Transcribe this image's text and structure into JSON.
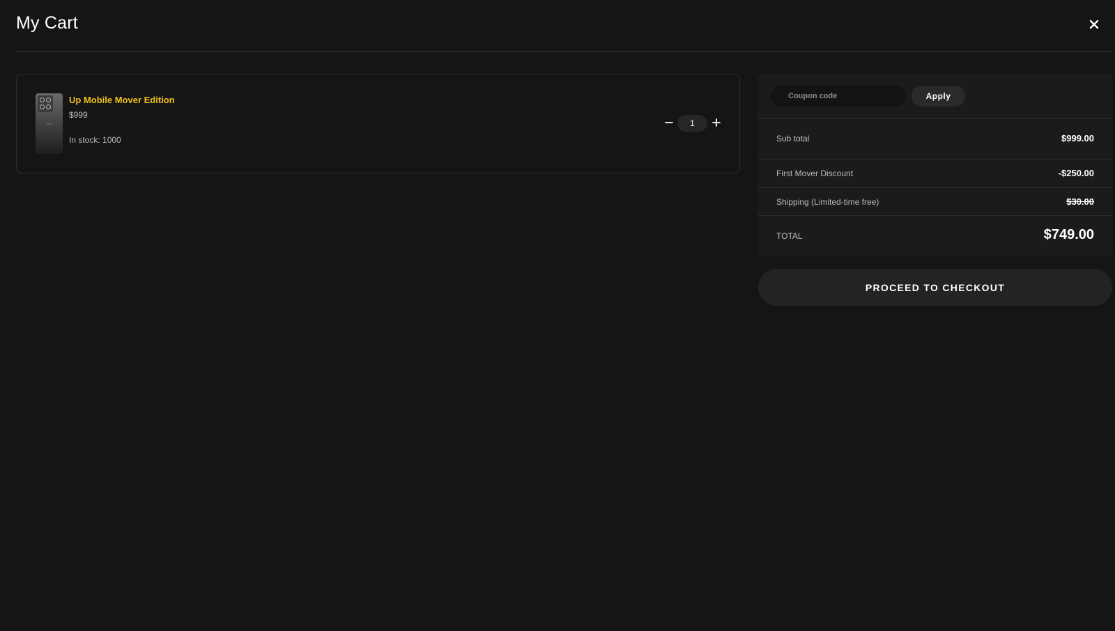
{
  "header": {
    "title": "My Cart",
    "close_icon": "close-icon"
  },
  "cart": {
    "items": [
      {
        "name": "Up Mobile Mover Edition",
        "price": "$999",
        "stock": "In stock: 1000",
        "quantity": "1",
        "image_icon": "phone-product-image"
      }
    ],
    "minus_icon": "minus-icon",
    "plus_icon": "plus-icon"
  },
  "summary": {
    "coupon_placeholder": "Coupon code",
    "apply_label": "Apply",
    "rows": [
      {
        "label": "Sub total",
        "value": "$999.00",
        "strike": false
      },
      {
        "label": "First Mover Discount",
        "value": "-$250.00",
        "strike": false
      },
      {
        "label": "Shipping (Limited-time free)",
        "value": "$30.00",
        "strike": true
      }
    ],
    "total_label": "TOTAL",
    "total_value": "$749.00"
  },
  "checkout": {
    "label": "PROCEED TO CHECKOUT"
  },
  "colors": {
    "background": "#151515",
    "panel": "#1b1b1b",
    "accent": "#f0c01e",
    "button": "#232323"
  }
}
